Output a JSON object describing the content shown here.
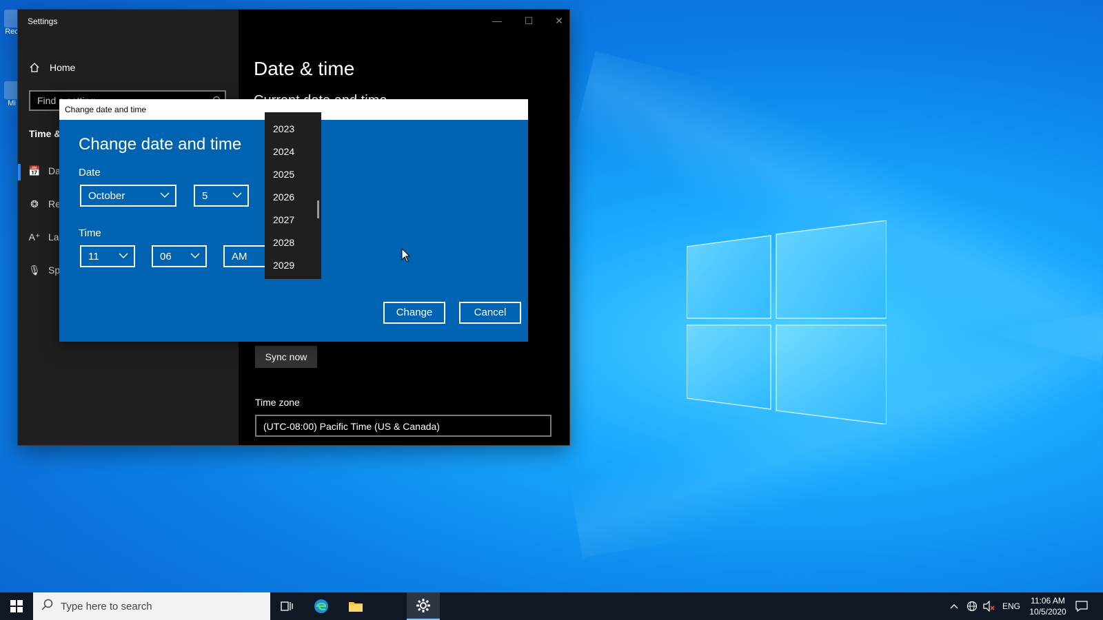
{
  "settings": {
    "window_title": "Settings",
    "home_label": "Home",
    "search_placeholder": "Find a setting",
    "section_label": "Time &",
    "nav_items": [
      "Da",
      "Re",
      "La",
      "Sp"
    ],
    "page_title": "Date & time",
    "subtitle": "Current date and time",
    "sync_label": "Sync now",
    "timezone_label": "Time zone",
    "timezone_value": "(UTC-08:00) Pacific Time (US & Canada)"
  },
  "dialog": {
    "window_title": "Change date and time",
    "heading": "Change date and time",
    "date_label": "Date",
    "month": "October",
    "day": "5",
    "time_label": "Time",
    "hour": "11",
    "minute": "06",
    "ampm": "AM",
    "year_options": [
      "2023",
      "2024",
      "2025",
      "2026",
      "2027",
      "2028",
      "2029"
    ],
    "change_label": "Change",
    "cancel_label": "Cancel"
  },
  "desktop": {
    "icon1_label": "Rec",
    "icon2_label": "Mi"
  },
  "taskbar": {
    "search_placeholder": "Type here to search",
    "language": "ENG",
    "time": "11:06 AM",
    "date": "10/5/2020"
  },
  "colors": {
    "dialog_bg": "#0063b1",
    "accent": "#1a8cff",
    "desktop_bg": "#0b7fe6",
    "taskbar_bg": "#101826"
  }
}
